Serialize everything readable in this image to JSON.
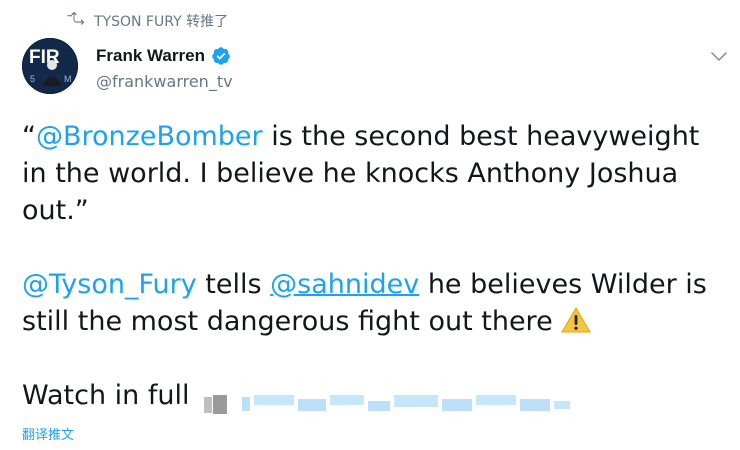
{
  "retweet": {
    "icon": "retweet-icon",
    "label": "TYSON FURY 转推了"
  },
  "author": {
    "name": "Frank Warren",
    "handle": "@frankwarren_tv",
    "verified": true,
    "avatar_icon": "avatar",
    "avatar_text": "FIR"
  },
  "tweet": {
    "line1_quote_open": "“",
    "line1_mention": "@BronzeBomber",
    "line1_rest": " is the second best heavyweight in the world. I believe he knocks Anthony Joshua out.”",
    "p2_mention1": "@Tyson_Fury",
    "p2_mid": " tells ",
    "p2_mention2": "@sahnidev",
    "p2_rest": " he believes Wilder is still the most dangerous fight out there ",
    "p2_emoji": "warning-icon",
    "p3_text": "Watch in full "
  },
  "translate_label": "翻译推文",
  "colors": {
    "link": "#1da1f2",
    "muted": "#657786",
    "text": "#14171a",
    "verified": "#1da1f2",
    "warn": "#f6c444"
  }
}
